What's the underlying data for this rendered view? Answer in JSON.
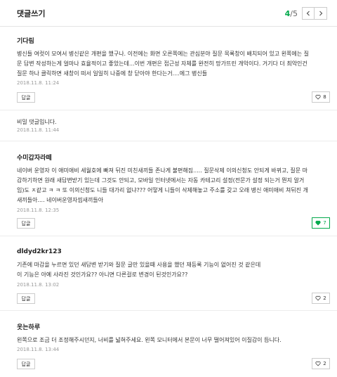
{
  "header": {
    "title": "댓글쓰기",
    "page_current": "4",
    "page_sep": "/",
    "page_total": "5"
  },
  "comments": [
    {
      "author": "기다림",
      "lines": [
        "병신들 여럿이 모여서 병신같은 개편을 했구나. 이전에는 화면 오른쪽에는 관심분야 질문 목록창이 배치되어 있고 왼쪽에는 질",
        "문 답변 작성하는게 얼마나 효율적이고 좋았는데...이번 개편은 접근성 자체를 완전히 망가뜨린 개악이다. 거기다 더 최악인건",
        "질문 하나 클릭하면 새창이 떠서 일일히 나중에 창 닫아야 한다는거....에그 병신들"
      ],
      "date": "2018.11.8. 11:24",
      "reply_label": "답글",
      "likes": "8",
      "liked": false
    },
    {
      "author": "",
      "lines": [
        "비밀 댓글입니다."
      ],
      "date": "2018.11.8. 11:44"
    },
    {
      "author": "수미갑자라떼",
      "lines": [
        "네이버 운영자 이 애미애비 세월호에 빠져 뒤진 미친새끼들 존나게 불편해짐..... 질문삭제 이의신청도 안되게 바뀌고, 질문 마",
        "감하기하면 원래 새답변받기 있는데 그것도 안되고, 모바일 인터넷에서는 자동 카테고리 설정(전문가 설정 되는거 뭔지 알거",
        "임)도 ㅈ같고 ㅋ ㅋ 또 이의신청도 니들 대가리 없냐??? 어떻게 니들이 삭제해놓고 주소를 갖고 오래 병신 애미애비 쳐뒤진 개",
        "새끼들아.... 네이버운영자씹새끼들아"
      ],
      "date": "2018.11.8. 12:35",
      "reply_label": "답글",
      "likes": "7",
      "liked": true
    },
    {
      "author": "dldyd2kr123",
      "lines": [
        "기존에 마감을 누르면 있던 새답변 받기와 질문 글만 있을때 사용을 했던 재등록 기능이 없어진 것 같은데",
        "이 기능은 아예 사라진 것인가요?? 아니면 다른걸로 변경이 된것인가요??"
      ],
      "date": "2018.11.8. 13:02",
      "reply_label": "답글",
      "likes": "2",
      "liked": false
    },
    {
      "author": "옷는하루",
      "lines": [
        "왼쪽으로 조금 더 조정해주시던지, 너비를 넓혀주세요. 왼쪽 모니터에서 본문이 너무 떨어져있어 이질감이 듭니다."
      ],
      "date": "2018.11.8. 13:44",
      "reply_label": "답글",
      "likes": "2",
      "liked": false
    }
  ],
  "colors": {
    "accent": "#03a94c",
    "border": "#cccccc",
    "muted": "#999999"
  },
  "icons": {
    "prev": "chevron-left-icon",
    "next": "chevron-right-icon",
    "heart": "heart-icon"
  }
}
